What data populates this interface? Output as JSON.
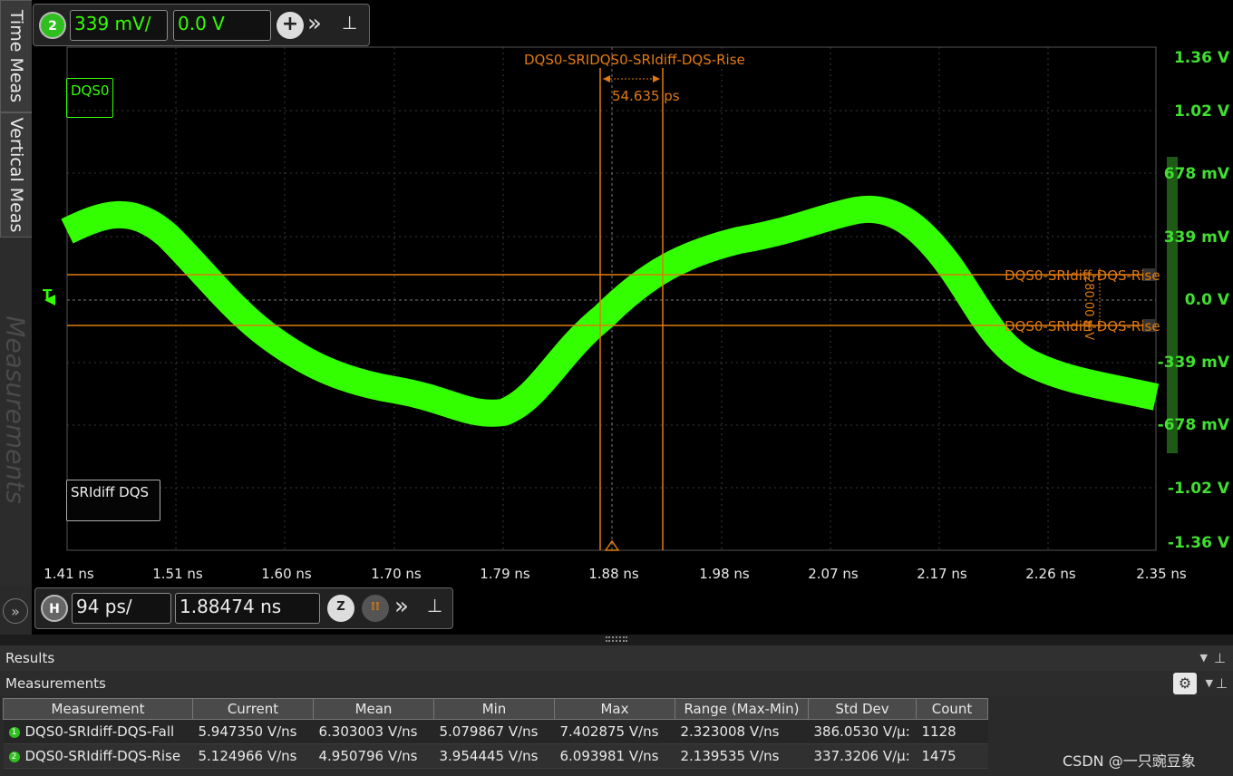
{
  "side_tabs": {
    "time_meas": "Time Meas",
    "vertical_meas": "Vertical Meas",
    "measurements_watermark": "Measurements"
  },
  "channel_bar": {
    "channel_number": "2",
    "scale": "339 mV/",
    "offset": "0.0 V"
  },
  "timebase_bar": {
    "badge": "H",
    "scale": "94 ps/",
    "position": "1.88474 ns"
  },
  "channel_labels": {
    "top_left": "DQS0",
    "bottom_left": "SRIdiff DQS"
  },
  "y_axis_labels": [
    "1.36 V",
    "1.02 V",
    "678 mV",
    "339 mV",
    "0.0 V",
    "-339 mV",
    "-678 mV",
    "-1.02 V",
    "-1.36 V"
  ],
  "x_axis_labels": [
    "1.41 ns",
    "1.51 ns",
    "1.60 ns",
    "1.70 ns",
    "1.79 ns",
    "1.88 ns",
    "1.98 ns",
    "2.07 ns",
    "2.17 ns",
    "2.26 ns",
    "2.35 ns"
  ],
  "annotations": {
    "marker_title": "DQS0-SRIDQS0-SRIdiff-DQS-Rise",
    "delta_time": "54.635 ps",
    "upper_threshold": "DQS0-SRIdiff-DQS-Rise",
    "lower_threshold": "DQS0-SRIdiff-DQS-Rise",
    "delta_voltage": "280.00 mV",
    "trigger_marker": "T"
  },
  "results": {
    "panel_title": "Results",
    "section_title": "Measurements",
    "columns": [
      "Measurement",
      "Current",
      "Mean",
      "Min",
      "Max",
      "Range (Max-Min)",
      "Std Dev",
      "Count"
    ],
    "rows": [
      {
        "badge": "1",
        "cells": [
          "DQS0-SRIdiff-DQS-Fall",
          "5.947350 V/ns",
          "6.303003 V/ns",
          "5.079867 V/ns",
          "7.402875 V/ns",
          "2.323008 V/ns",
          "386.0530 V/µ:",
          "1128"
        ]
      },
      {
        "badge": "2",
        "cells": [
          "DQS0-SRIdiff-DQS-Rise",
          "5.124966 V/ns",
          "4.950796 V/ns",
          "3.954445 V/ns",
          "6.093981 V/ns",
          "2.139535 V/ns",
          "337.3206 V/µ:",
          "1475"
        ]
      }
    ]
  },
  "watermark": "CSDN @一只豌豆象",
  "colors": {
    "trace": "#33ff00",
    "cursor": "#e07a10",
    "axis_label": "#40e030"
  }
}
